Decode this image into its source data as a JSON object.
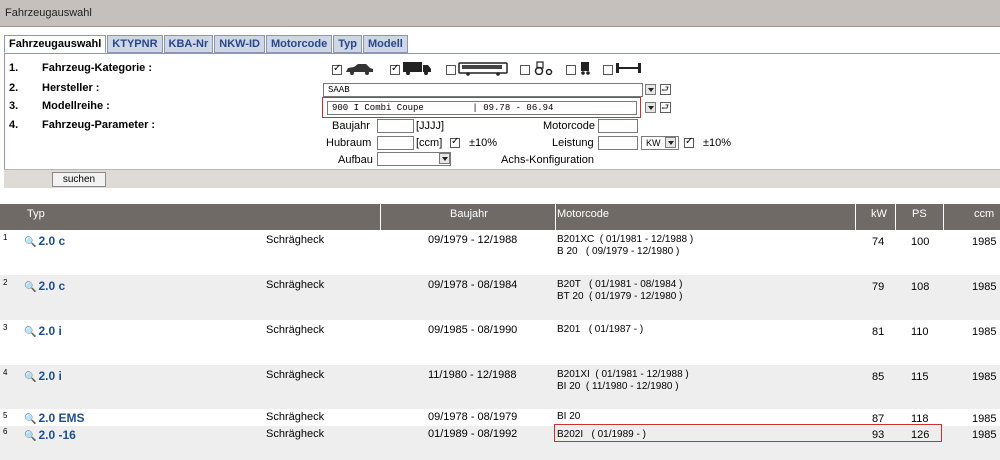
{
  "window": {
    "title": "Fahrzeugauswahl"
  },
  "tabs": [
    "Fahrzeugauswahl",
    "KTYPNR",
    "KBA-Nr",
    "NKW-ID",
    "Motorcode",
    "Typ",
    "Modell"
  ],
  "form": {
    "rows": [
      {
        "num": "1.",
        "label": "Fahrzeug-Kategorie :"
      },
      {
        "num": "2.",
        "label": "Hersteller :"
      },
      {
        "num": "3.",
        "label": "Modellreihe :"
      },
      {
        "num": "4.",
        "label": "Fahrzeug-Parameter :"
      }
    ],
    "categories": [
      {
        "icon": "car-icon",
        "checked": true
      },
      {
        "icon": "truck-icon",
        "checked": true
      },
      {
        "icon": "bus-icon",
        "checked": false
      },
      {
        "icon": "tractor-icon",
        "checked": false
      },
      {
        "icon": "trailer-icon",
        "checked": false
      },
      {
        "icon": "axle-icon",
        "checked": false
      }
    ],
    "hersteller": "SAAB",
    "modellreihe": "900 I Combi Coupe         | 09.78 - 06.94",
    "params": {
      "baujahr_label": "Baujahr",
      "baujahr_hint": "[JJJJ]",
      "hubraum_label": "Hubraum",
      "hubraum_unit": "[ccm]",
      "hubraum_tol": "±10%",
      "aufbau_label": "Aufbau",
      "motorcode_label": "Motorcode",
      "leistung_label": "Leistung",
      "leistung_unit": "KW",
      "leistung_tol": "±10%",
      "achs_label": "Achs-Konfiguration"
    },
    "search_button": "suchen"
  },
  "table": {
    "headers": [
      "Typ",
      "Baujahr",
      "Motorcode",
      "kW",
      "PS",
      "ccm"
    ],
    "rows": [
      {
        "idx": "1",
        "typ": "2.0 c",
        "body": "Schrägheck",
        "baujahr": "09/1979 - 12/1988",
        "motorcodes": [
          "B201XC  ( 01/1981 - 12/1988 )",
          "B 20   ( 09/1979 - 12/1980 )"
        ],
        "kw": "74",
        "ps": "100",
        "ccm": "1985"
      },
      {
        "idx": "2",
        "typ": "2.0 c",
        "body": "Schrägheck",
        "baujahr": "09/1978 - 08/1984",
        "motorcodes": [
          "B20T   ( 01/1981 - 08/1984 )",
          "BT 20  ( 01/1979 - 12/1980 )"
        ],
        "kw": "79",
        "ps": "108",
        "ccm": "1985"
      },
      {
        "idx": "3",
        "typ": "2.0 i",
        "body": "Schrägheck",
        "baujahr": "09/1985 - 08/1990",
        "motorcodes": [
          "B201   ( 01/1987 - )"
        ],
        "kw": "81",
        "ps": "110",
        "ccm": "1985"
      },
      {
        "idx": "4",
        "typ": "2.0 i",
        "body": "Schrägheck",
        "baujahr": "11/1980 - 12/1988",
        "motorcodes": [
          "B201XI  ( 01/1981 - 12/1988 )",
          "BI 20  ( 11/1980 - 12/1980 )"
        ],
        "kw": "85",
        "ps": "115",
        "ccm": "1985"
      },
      {
        "idx": "5",
        "typ": "2.0 EMS",
        "body": "Schrägheck",
        "baujahr": "09/1978 - 08/1979",
        "motorcodes": [
          "BI 20"
        ],
        "kw": "87",
        "ps": "118",
        "ccm": "1985"
      },
      {
        "idx": "6",
        "typ": "2.0 -16",
        "body": "Schrägheck",
        "baujahr": "01/1989 - 08/1992",
        "motorcodes": [
          "B202I   ( 01/1989 - )"
        ],
        "kw": "93",
        "ps": "126",
        "ccm": "1985"
      }
    ]
  }
}
